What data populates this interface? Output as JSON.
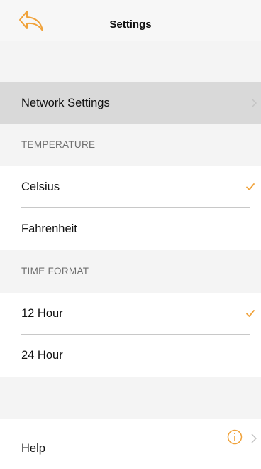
{
  "header": {
    "title": "Settings",
    "back_icon": "back-arrow-icon",
    "accent_color": "#f0a23a"
  },
  "network": {
    "label": "Network Settings"
  },
  "temperature": {
    "header": "TEMPERATURE",
    "options": [
      {
        "label": "Celsius",
        "selected": true
      },
      {
        "label": "Fahrenheit",
        "selected": false
      }
    ]
  },
  "time_format": {
    "header": "TIME FORMAT",
    "options": [
      {
        "label": "12 Hour",
        "selected": true
      },
      {
        "label": "24 Hour",
        "selected": false
      }
    ]
  },
  "help": {
    "label": "Help",
    "icon": "info-icon"
  }
}
